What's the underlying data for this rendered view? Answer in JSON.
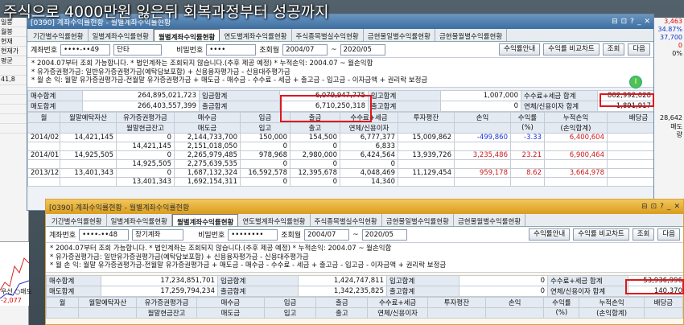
{
  "headline": "주식으로 4000만원 잃은뒤 회복과정부터 성공까지",
  "left_strip": [
    "일봉",
    "월봉",
    "현재",
    "현재가",
    "평균",
    "",
    "41,8",
    "",
    "",
    "",
    "",
    ""
  ],
  "left_bottom": [
    "우선 ○매도",
    "-2,077"
  ],
  "right_strip": [
    "3,463",
    "34.87%",
    "37,700",
    "0",
    "0%",
    "",
    "",
    "",
    "",
    "",
    "",
    "",
    "28,642",
    "매도",
    "량"
  ],
  "w1": {
    "title": "[0390] 계좌수익률현황 - 월별계좌수익률현황",
    "tabs": [
      "기간별수익률현황",
      "일별계좌수익률현황",
      "월별계좌수익률현황",
      "연도별계좌수익률현황",
      "주식종목별실수익현황",
      "금현물일별수익률현황",
      "금현물월별수익률현황"
    ],
    "active_tab": 2,
    "ctrl": {
      "acct_label": "계좌번호",
      "acct": "••••-••49",
      "type": "단타",
      "pw_label": "비밀번호",
      "pw": "••••",
      "period_label": "조회월",
      "from": "2004/07",
      "to": "2020/05",
      "btn1": "수익률안내",
      "btn2": "수익률 비교차트",
      "btn3": "조회",
      "btn4": "다음"
    },
    "notes": [
      "* 2004.07부터 조회 가능합니다.  * 법인계좌는 조회되지 않습니다.(추후 제공 예정)  * 누적손익: 2004.07 ~ 월손익합",
      "* 유가증권평가금: 일반유가증권평가금(예탁담보포함) + 신용융자평가금 - 신용대주평가금",
      "* 월 손 익: 월말 유가증권평가금-전월말 유가증권평가금 + 매도금 - 매수금 - 수수료 - 세금 + 출고금 - 입고금 - 이자금액 + 권리락 보정금"
    ],
    "summary": [
      [
        "매수합계",
        "264,895,021,723",
        "입금합계",
        "6,079,947,775",
        "입고합계",
        "1,007,000",
        "수수료+세금 합계",
        "802,992,028"
      ],
      [
        "매도합계",
        "266,403,557,399",
        "출금합계",
        "6,710,250,318",
        "출고합계",
        "0",
        "연체/신용이자 합계",
        "1,891,917"
      ]
    ],
    "headers": {
      "top": [
        "월",
        "월말예탁자산",
        "유가증권평가금",
        "매수금",
        "입금",
        "출금",
        "수수료+세금",
        "투자평잔",
        "손익",
        "수익률",
        "누적손익",
        "배당금"
      ],
      "bottom": [
        "",
        "",
        "월말현금잔고",
        "매도금",
        "입고",
        "출고",
        "연체/신용이자",
        "",
        "",
        "(%)",
        "(손익합계)",
        ""
      ]
    },
    "rows": [
      {
        "a": [
          "2014/02",
          "14,421,145",
          "0",
          "2,144,733,700",
          "150,000",
          "154,500",
          "6,777,377",
          "15,009,862",
          "-499,860",
          "-3.33",
          "6,400,604",
          "0"
        ],
        "b": [
          "",
          "",
          "14,421,145",
          "2,151,018,050",
          "0",
          "0",
          "6,833",
          "",
          "",
          "",
          "",
          ""
        ]
      },
      {
        "a": [
          "2014/01",
          "14,925,505",
          "0",
          "2,265,979,485",
          "978,968",
          "2,980,000",
          "6,424,564",
          "13,939,726",
          "3,235,486",
          "23.21",
          "6,900,464",
          "0"
        ],
        "b": [
          "",
          "",
          "14,925,505",
          "2,275,639,535",
          "0",
          "0",
          "0",
          "",
          "",
          "",
          "",
          ""
        ]
      },
      {
        "a": [
          "2013/12",
          "13,401,343",
          "0",
          "1,687,132,324",
          "16,592,578",
          "12,395,678",
          "4,048,469",
          "11,129,454",
          "959,178",
          "8.62",
          "3,664,978",
          "0"
        ],
        "b": [
          "",
          "",
          "13,401,343",
          "1,692,154,311",
          "0",
          "0",
          "14,340",
          "",
          "",
          "",
          "",
          ""
        ]
      }
    ]
  },
  "w2": {
    "title": "[0390] 계좌수익률현황 - 월별계좌수익률현황",
    "tabs": [
      "기간별수익률현황",
      "일별계좌수익률현황",
      "월별계좌수익률현황",
      "연도별계좌수익률현황",
      "주식종목별실수익현황",
      "금현물일별수익률현황",
      "금현물월별수익률현황"
    ],
    "active_tab": 2,
    "ctrl": {
      "acct_label": "계좌번호",
      "acct": "••••-••48",
      "type": "장기계좌",
      "pw_label": "비밀번호",
      "pw": "••••••••",
      "period_label": "조회월",
      "from": "2004/07",
      "to": "2020/05",
      "btn1": "수익률안내",
      "btn2": "수익률 비교차트",
      "btn3": "조회",
      "btn4": "다음"
    },
    "notes": [
      "* 2004.07부터 조회 가능합니다.  * 법인계좌는 조회되지 않습니다.(추후 제공 예정)  * 누적손익: 2004.07 ~ 월손익합",
      "* 유가증권평가금: 일반유가증권평가금(예탁담보포함) + 신용융자평가금 - 신용대주평가금",
      "* 월 손 익: 월말 유가증권평가금-전월말 유가증권평가금 + 매도금 - 매수금 - 수수료 - 세금 + 출고금 - 입고금 - 이자금액 + 권리락 보정금"
    ],
    "summary": [
      [
        "매수합계",
        "17,234,851,701",
        "입금합계",
        "1,424,747,811",
        "입고합계",
        "0",
        "수수료+세금 합계",
        "53,936,996"
      ],
      [
        "매도합계",
        "17,259,794,234",
        "출금합계",
        "1,342,235,825",
        "출고합계",
        "0",
        "연체/신용이자 합계",
        "140,370"
      ]
    ],
    "headers": {
      "top": [
        "월",
        "월말예탁자산",
        "유가증권평가금",
        "매수금",
        "입금",
        "출금",
        "수수료+세금",
        "투자평잔",
        "손익",
        "수익률",
        "누적손익",
        "배당금"
      ],
      "bottom": [
        "",
        "",
        "월말현금잔고",
        "매도금",
        "입고",
        "출고",
        "연체/신용이자",
        "",
        "",
        "(%)",
        "(손익합계)",
        ""
      ]
    }
  },
  "sidemark": "2013/"
}
